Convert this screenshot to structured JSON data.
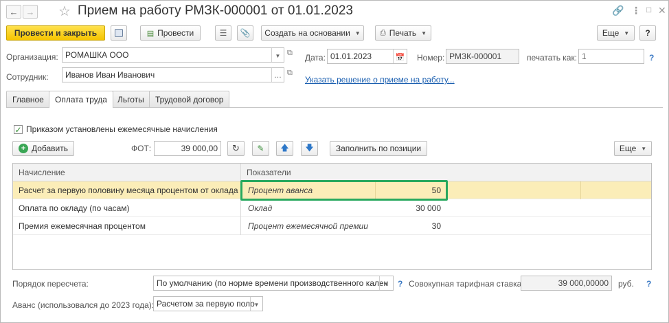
{
  "window": {
    "title": "Прием на работу РМЗК-000001 от 01.01.2023"
  },
  "toolbar": {
    "post_close_label": "Провести и закрыть",
    "post_label": "Провести",
    "create_based_label": "Создать на основании",
    "print_label": "Печать",
    "more_label": "Еще",
    "help_label": "?"
  },
  "header": {
    "org_label": "Организация:",
    "org_value": "РОМАШКА ООО",
    "employee_label": "Сотрудник:",
    "employee_value": "Иванов Иван Иванович",
    "date_label": "Дата:",
    "date_value": "01.01.2023",
    "number_label": "Номер:",
    "number_value": "РМЗК-000001",
    "print_as_label": "печатать как:",
    "print_as_placeholder": "1",
    "help": "?",
    "decision_link": "Указать решение о приеме на работу..."
  },
  "tabs": [
    {
      "label": "Главное"
    },
    {
      "label": "Оплата труда"
    },
    {
      "label": "Льготы"
    },
    {
      "label": "Трудовой договор"
    }
  ],
  "pay": {
    "monthly_charges_checkbox": "Приказом установлены ежемесячные начисления",
    "monthly_charges_checked": true,
    "add_label": "Добавить",
    "fot_label": "ФОТ:",
    "fot_value": "39 000,00",
    "fill_by_position_label": "Заполнить по позиции",
    "more_label": "Еще"
  },
  "table": {
    "columns": [
      "Начисление",
      "Показатели"
    ],
    "rows": [
      {
        "charge": "Расчет за первую половину месяца процентом от оклада",
        "indicator": "Процент аванса",
        "value": "50",
        "selected": true
      },
      {
        "charge": "Оплата по окладу (по часам)",
        "indicator": "Оклад",
        "value": "30 000",
        "selected": false
      },
      {
        "charge": "Премия ежемесячная процентом",
        "indicator": "Процент ежемесячной премии",
        "value": "30",
        "selected": false
      }
    ]
  },
  "footer": {
    "recalc_label": "Порядок пересчета:",
    "recalc_value": "По умолчанию (по норме времени производственного кален",
    "help": "?",
    "tariff_label": "Совокупная тарифная ставка:",
    "tariff_value": "39 000,00000",
    "tariff_unit": "руб.",
    "advance_label": "Аванс (использовался до 2023 года):",
    "advance_value": "Расчетом за первую поло"
  },
  "colors": {
    "primary_button": "#f5c400",
    "selected_row": "#fbedb8",
    "highlight_frame": "#27a85e",
    "link": "#1b5fb0"
  }
}
